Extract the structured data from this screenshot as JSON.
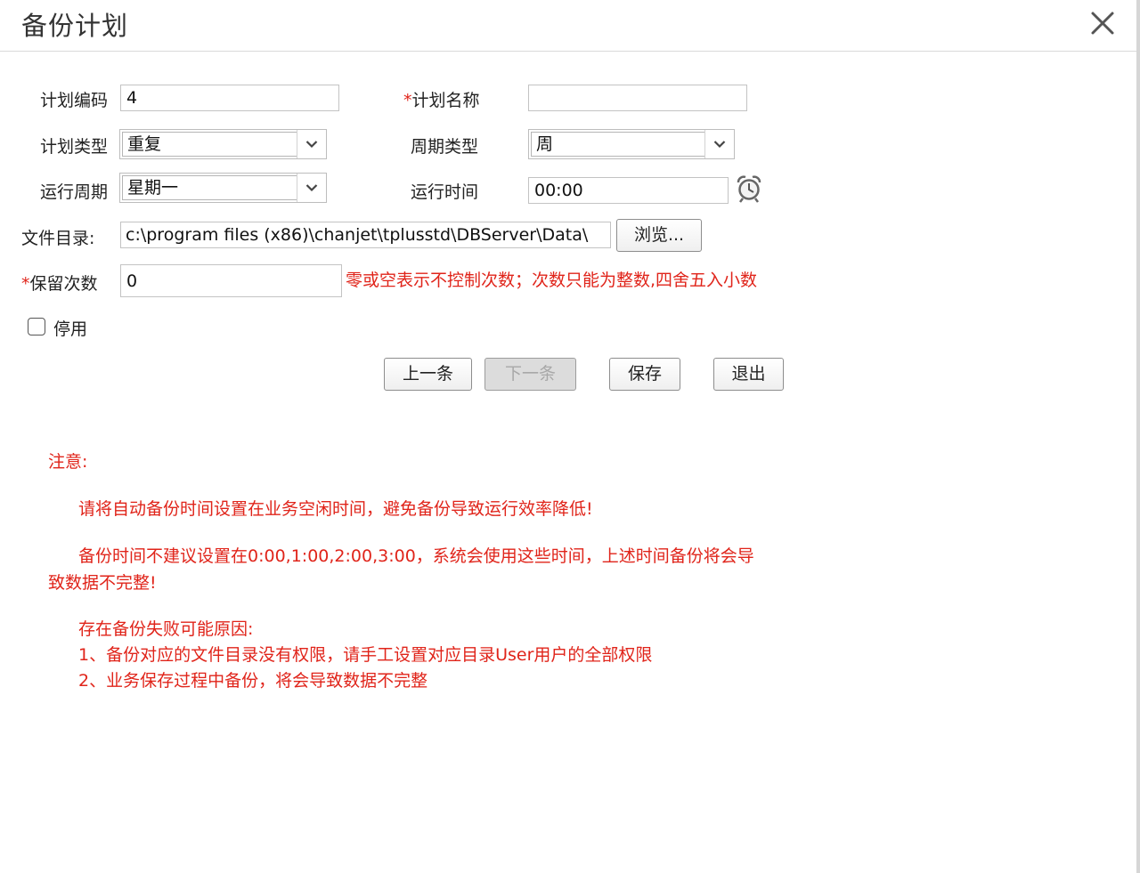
{
  "dialog": {
    "title": "备份计划"
  },
  "form": {
    "plan_code": {
      "label": "计划编码",
      "value": "4"
    },
    "plan_name": {
      "required_mark": "*",
      "label": "计划名称",
      "value": ""
    },
    "plan_type": {
      "label": "计划类型",
      "value": "重复"
    },
    "cycle_type": {
      "label": "周期类型",
      "value": "周"
    },
    "run_cycle": {
      "label": "运行周期",
      "value": "星期一"
    },
    "run_time": {
      "label": "运行时间",
      "value": "00:00"
    },
    "file_dir": {
      "label": "文件目录:",
      "value": "c:\\program files (x86)\\chanjet\\tplusstd\\DBServer\\Data\\",
      "browse_label": "浏览..."
    },
    "retain_count": {
      "required_mark": "*",
      "label": "保留次数",
      "value": "0",
      "hint": "零或空表示不控制次数；次数只能为整数,四舍五入小数"
    },
    "disable": {
      "label": "停用",
      "checked": false
    }
  },
  "actions": {
    "prev_label": "上一条",
    "next_label": "下一条",
    "save_label": "保存",
    "exit_label": "退出"
  },
  "notes": {
    "heading": "注意:",
    "line1": "请将自动备份时间设置在业务空闲时间，避免备份导致运行效率降低!",
    "line2a": "备份时间不建议设置在0:00,1:00,2:00,3:00，系统会使用这些时间，上述时间备份将会导",
    "line2b": "致数据不完整!",
    "line3": "存在备份失败可能原因:",
    "line4": "1、备份对应的文件目录没有权限，请手工设置对应目录User用户的全部权限",
    "line5": "2、业务保存过程中备份，将会导致数据不完整"
  },
  "icons": {
    "close": "close-icon",
    "dropdown": "chevron-down-icon",
    "clock": "alarm-clock-icon"
  },
  "colors": {
    "warning_text": "#e0241a",
    "border": "#c3c3c3",
    "disabled_button": "#dcdcdc"
  }
}
